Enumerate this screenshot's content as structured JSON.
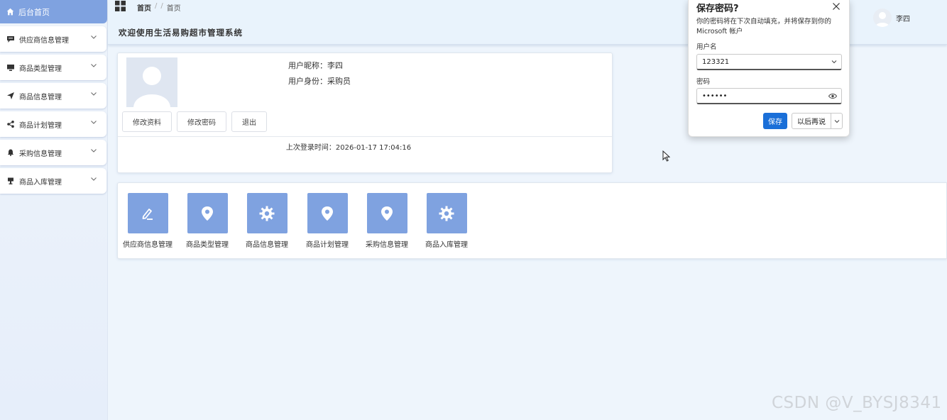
{
  "sidebar": {
    "home_label": "后台首页",
    "items": [
      {
        "label": "供应商信息管理",
        "icon": "comment-icon"
      },
      {
        "label": "商品类型管理",
        "icon": "monitor-icon"
      },
      {
        "label": "商品信息管理",
        "icon": "send-icon"
      },
      {
        "label": "商品计划管理",
        "icon": "share-icon"
      },
      {
        "label": "采购信息管理",
        "icon": "bell-icon"
      },
      {
        "label": "商品入库管理",
        "icon": "cup-icon"
      }
    ]
  },
  "header": {
    "breadcrumb": [
      "首页",
      "/",
      "/",
      "首页"
    ],
    "welcome": "欢迎使用生活易购超市管理系统",
    "user_name": "李四"
  },
  "profile": {
    "nickname_line": "用户昵称：李四",
    "role_line": "用户身份：采购员",
    "edit_label": "修改资料",
    "password_label": "修改密码",
    "logout_label": "退出",
    "last_login": "上次登录时间：2026-01-17 17:04:16"
  },
  "quick_nav": [
    {
      "label": "供应商信息管理",
      "icon": "edit-icon"
    },
    {
      "label": "商品类型管理",
      "icon": "location-icon"
    },
    {
      "label": "商品信息管理",
      "icon": "gear-icon"
    },
    {
      "label": "商品计划管理",
      "icon": "location-icon"
    },
    {
      "label": "采购信息管理",
      "icon": "location-icon"
    },
    {
      "label": "商品入库管理",
      "icon": "gear-icon"
    }
  ],
  "password_popup": {
    "title": "保存密码?",
    "description": "你的密码将在下次自动填充，并将保存到你的 Microsoft 帐户",
    "username_label": "用户名",
    "username_value": "123321",
    "password_label": "密码",
    "password_value": "••••••",
    "save_label": "保存",
    "later_label": "以后再说"
  },
  "watermark": "CSDN @V_BYSJ8341",
  "colors": {
    "accent": "#7fa2e0",
    "primary_button": "#1a6fd8",
    "background": "#eef5fc"
  }
}
